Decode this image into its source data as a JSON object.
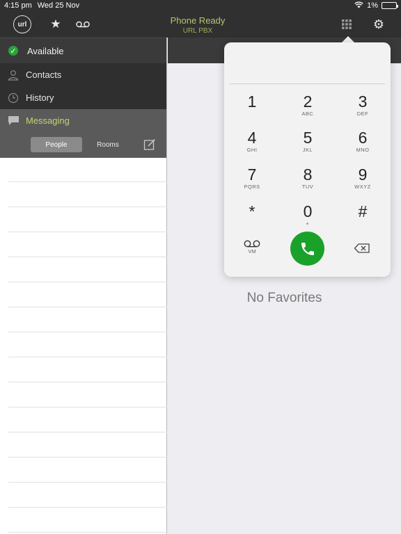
{
  "status_bar": {
    "time": "4:15 pm",
    "date": "Wed 25 Nov",
    "battery": "1%"
  },
  "header": {
    "logo_text": "url",
    "status_title": "Phone Ready",
    "status_subtitle": "URL PBX"
  },
  "sidebar": {
    "presence": "Available",
    "items": [
      {
        "label": "Contacts"
      },
      {
        "label": "History"
      },
      {
        "label": "Messaging"
      }
    ],
    "segments": [
      {
        "label": "People"
      },
      {
        "label": "Rooms"
      }
    ]
  },
  "dialpad": {
    "keys": [
      {
        "digit": "1",
        "letters": ""
      },
      {
        "digit": "2",
        "letters": "ABC"
      },
      {
        "digit": "3",
        "letters": "DEF"
      },
      {
        "digit": "4",
        "letters": "GHI"
      },
      {
        "digit": "5",
        "letters": "JKL"
      },
      {
        "digit": "6",
        "letters": "MNO"
      },
      {
        "digit": "7",
        "letters": "PQRS"
      },
      {
        "digit": "8",
        "letters": "TUV"
      },
      {
        "digit": "9",
        "letters": "WXYZ"
      },
      {
        "digit": "*",
        "letters": ""
      },
      {
        "digit": "0",
        "letters": "+"
      },
      {
        "digit": "#",
        "letters": ""
      }
    ],
    "vm_label": "VM"
  },
  "main": {
    "empty_text": "No Favorites"
  },
  "colors": {
    "accent": "#c6d270",
    "call": "#1aa12a",
    "dark": "#303030"
  }
}
